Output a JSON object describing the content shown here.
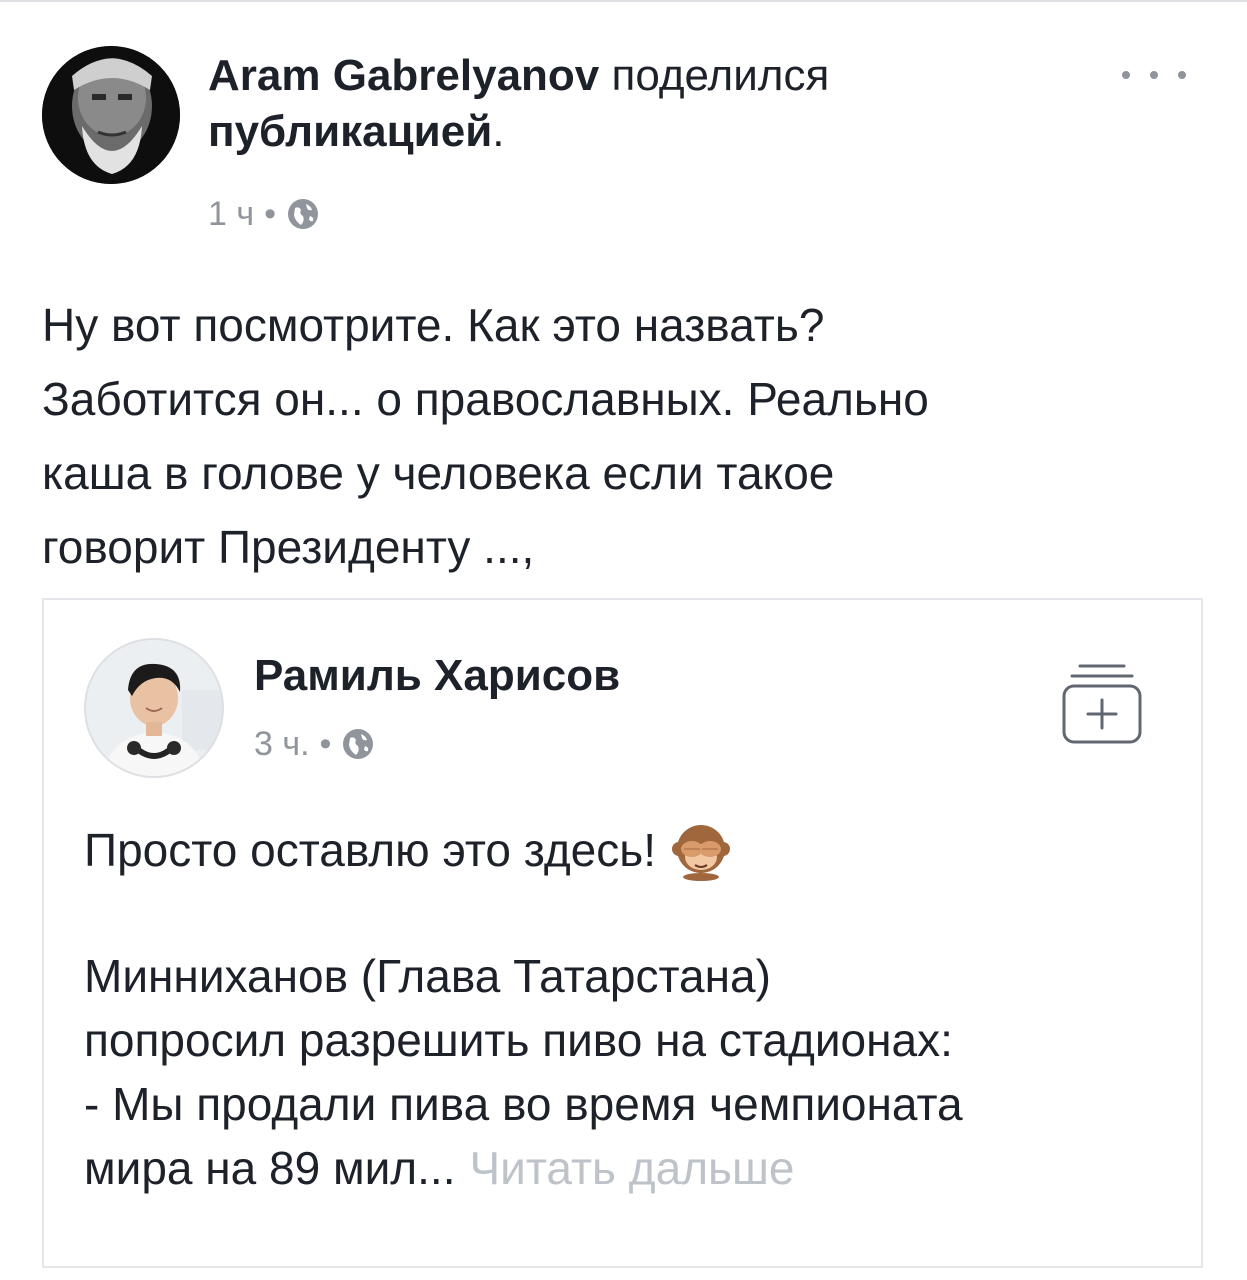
{
  "post": {
    "author": "Aram Gabrelyanov",
    "action_normal": " поделился ",
    "action_bold": "публикацией",
    "action_end": ".",
    "time": "1 ч",
    "separator": "•",
    "privacy_icon": "globe-icon",
    "more_icon": "ellipsis-icon",
    "text": "Ну вот посмотрите. Как это назвать?\nЗаботится он... о православных. Реально\nкаша в голове у человека если такое\nговорит Президенту ...,"
  },
  "shared": {
    "author": "Рамиль Харисов",
    "time": "3 ч.",
    "separator": "•",
    "privacy_icon": "globe-icon",
    "save_icon": "save-collection-icon",
    "line1": "Просто оставлю это здесь!",
    "emoji_icon": "see-no-evil-monkey-icon",
    "paragraph": "Минниханов (Глава Татарстана)\nпопросил разрешить пиво на стадионах:\n- Мы продали пива во время чемпионата\nмира на 89 мил...",
    "read_more": "Читать дальше"
  },
  "colors": {
    "text": "#1d2129",
    "meta": "#90949c",
    "read_more": "#bec3c9",
    "border": "#e4e6eb"
  }
}
